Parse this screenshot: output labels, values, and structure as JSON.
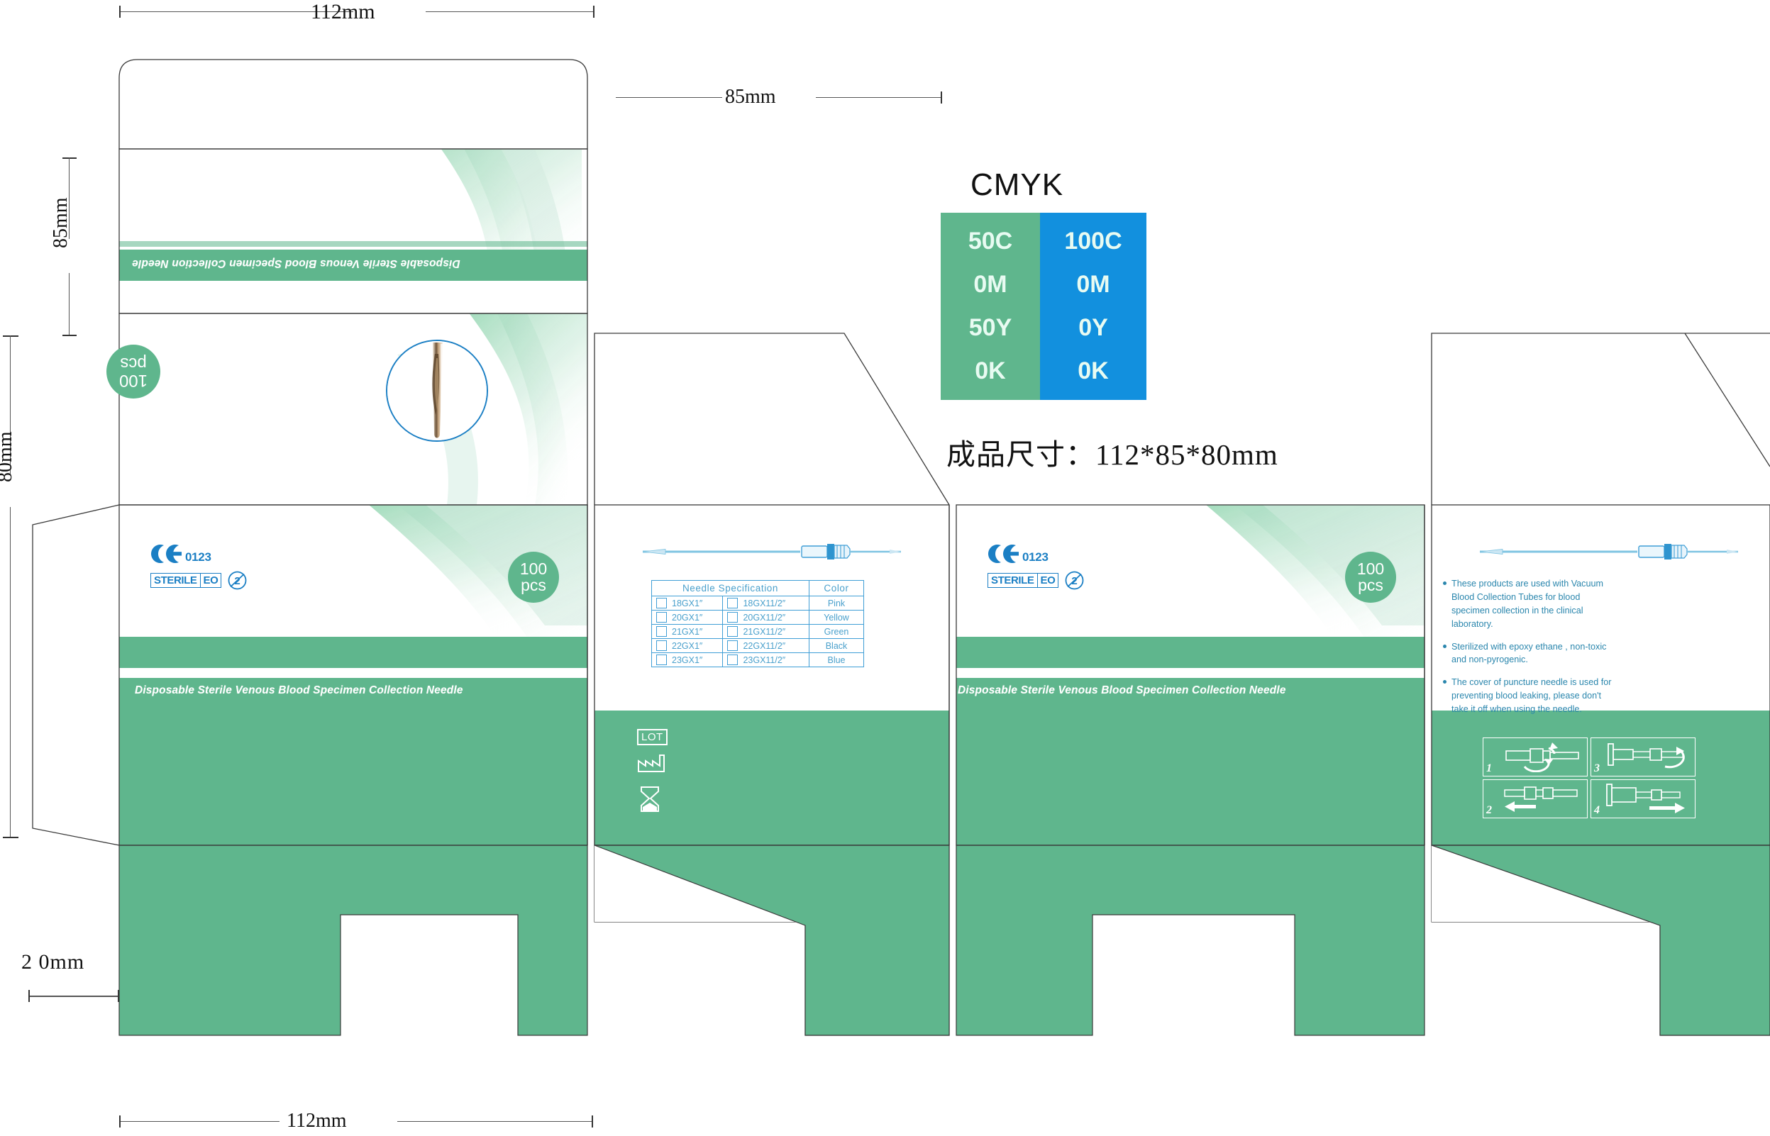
{
  "document": {
    "type": "packaging-dieline",
    "product_title": "Disposable Sterile Venous Blood Specimen Collection Needle"
  },
  "dimensions": {
    "width_top": "112mm",
    "depth_top": "85mm",
    "height_left_upper": "85mm",
    "height_left_lower": "80mm",
    "flap_depth": "2 0mm",
    "width_bottom": "112mm"
  },
  "cmyk": {
    "heading": "CMYK",
    "swatches": [
      {
        "name": "green-swatch",
        "hex": "#5fb68d",
        "values": [
          "50C",
          "0M",
          "50Y",
          "0K"
        ]
      },
      {
        "name": "blue-swatch",
        "hex": "#1290de",
        "values": [
          "100C",
          "0M",
          "0Y",
          "0K"
        ]
      }
    ],
    "size_note": "成品尺寸：112*85*80mm"
  },
  "panels": {
    "front": {
      "title": "Disposable Sterile Venous Blood Specimen Collection Needle",
      "pcs_count": "100",
      "pcs_unit": "pcs",
      "ce_mark": "CE",
      "ce_number": "0123",
      "sterile_left": "STERILE",
      "sterile_right": "EO",
      "single_use_symbol": "do-not-reuse-icon"
    },
    "back": {
      "title": "Disposable Sterile Venous Blood Specimen Collection Needle",
      "pcs_count": "100",
      "pcs_unit": "pcs",
      "ce_mark": "CE",
      "ce_number": "0123",
      "sterile_left": "STERILE",
      "sterile_right": "EO"
    },
    "top_flap": {
      "title": "Disposable Sterile Venous Blood Specimen Collection Needle",
      "pcs_count": "100",
      "pcs_unit": "pcs"
    },
    "side_left": {
      "symbols": [
        "LOT",
        "manufacturer-icon",
        "use-by-date-icon"
      ],
      "lot_label": "LOT"
    },
    "side_right": {
      "steps": [
        "1",
        "2",
        "3",
        "4"
      ]
    }
  },
  "spec_table": {
    "headers": [
      "Needle  Specification",
      "Color"
    ],
    "rows": [
      {
        "spec_a": "18GX1″",
        "spec_b": "18GX11/2″",
        "color": "Pink"
      },
      {
        "spec_a": "20GX1″",
        "spec_b": "20GX11/2″",
        "color": "Yellow"
      },
      {
        "spec_a": "21GX1″",
        "spec_b": "21GX11/2″",
        "color": "Green"
      },
      {
        "spec_a": "22GX1″",
        "spec_b": "22GX11/2″",
        "color": "Black"
      },
      {
        "spec_a": "23GX1″",
        "spec_b": "23GX11/2″",
        "color": "Blue"
      }
    ]
  },
  "info_bullets": [
    "These products are used with Vacuum Blood Collection Tubes for blood specimen collection in the clinical laboratory.",
    "Sterilized with epoxy ethane , non-toxic and non-pyrogenic.",
    "The cover of puncture needle is used for preventing blood leaking, please don't take it off when using the needle."
  ],
  "colors": {
    "brand_green": "#5fb68d",
    "brand_blue": "#1290de",
    "line_blue": "#1b7fc4",
    "text_blue": "#2a86ad",
    "cut_line": "#3a3a3a"
  }
}
